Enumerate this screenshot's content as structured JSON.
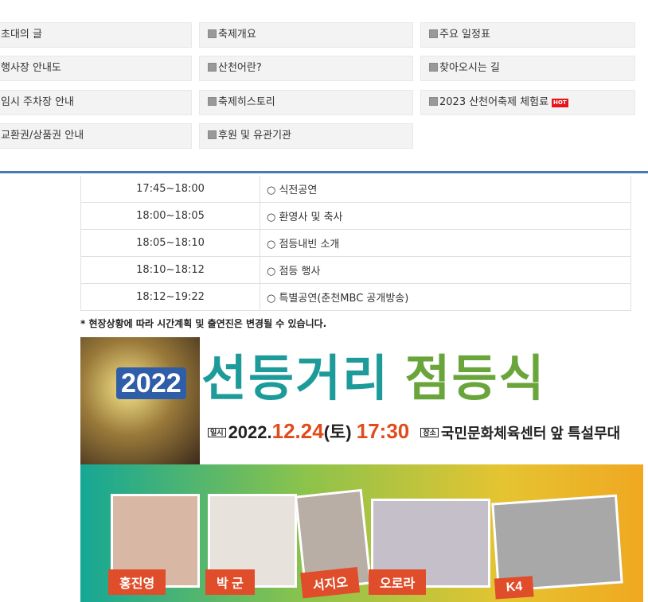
{
  "menu": {
    "rows": [
      [
        "초대의 글",
        "축제개요",
        "주요 일정표"
      ],
      [
        "행사장 안내도",
        "산천어란?",
        "찾아오시는 길"
      ],
      [
        "임시 주차장 안내",
        "축제히스토리",
        "2023 산천어축제 체험료"
      ],
      [
        "교환권/상품권 안내",
        "후원 및 유관기관",
        ""
      ]
    ],
    "hot_badge": "HOT"
  },
  "schedule": [
    {
      "time": "17:45~18:00",
      "program": "○ 식전공연"
    },
    {
      "time": "18:00~18:05",
      "program": "○ 환영사 및 축사"
    },
    {
      "time": "18:05~18:10",
      "program": "○ 점등내빈 소개"
    },
    {
      "time": "18:10~18:12",
      "program": "○ 점등 행사"
    },
    {
      "time": "18:12~19:22",
      "program": "○ 특별공연(춘천MBC 공개방송)"
    }
  ],
  "note": "* 현장상황에 따라 시간계획 및 출연진은 변경될 수 있습니다.",
  "banner": {
    "year": "2022",
    "title_a": "선등거리",
    "title_b": "점등식",
    "date_tag": "일시",
    "date_prefix": "2022.",
    "date_big": "12.24",
    "date_day": "(토)",
    "date_time": "17:30",
    "place_tag": "장소",
    "place": "국민문화체육센터 앞 특설무대",
    "performers": [
      "홍진영",
      "박 군",
      "서지오",
      "오로라",
      "K4"
    ]
  }
}
